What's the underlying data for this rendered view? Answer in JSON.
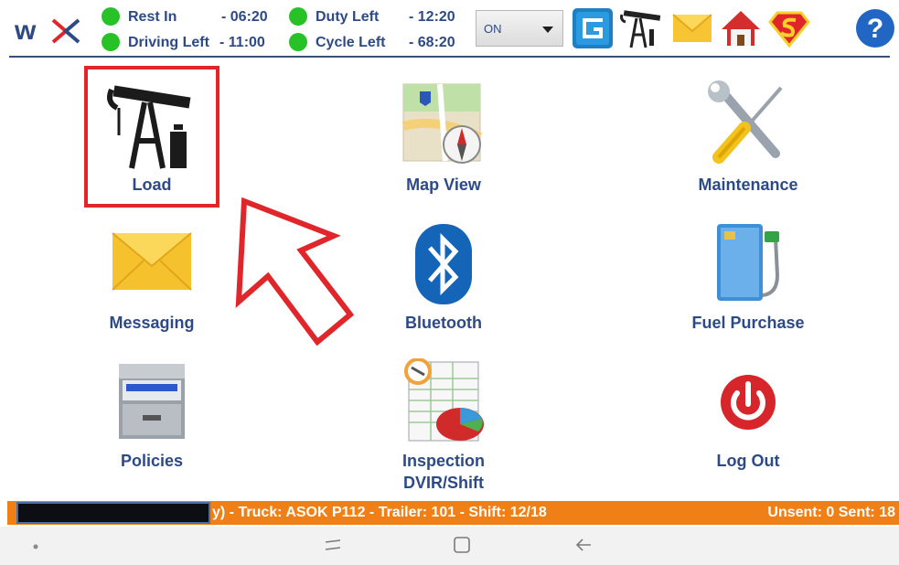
{
  "status": {
    "rest_in_label": "Rest In",
    "rest_in_value": "- 06:20",
    "driving_left_label": "Driving Left",
    "driving_left_value": "- 11:00",
    "duty_left_label": "Duty Left",
    "duty_left_value": "- 12:20",
    "cycle_left_label": "Cycle Left",
    "cycle_left_value": "- 68:20",
    "indicator_color": "#27c227"
  },
  "duty_select": {
    "selected": "ON"
  },
  "header_icons": [
    "g-app-icon",
    "pumpjack-icon",
    "envelope-icon",
    "home-icon",
    "superman-icon",
    "help-icon"
  ],
  "tiles": {
    "load": "Load",
    "map_view": "Map View",
    "maintenance": "Maintenance",
    "messaging": "Messaging",
    "bluetooth": "Bluetooth",
    "fuel_purchase": "Fuel Purchase",
    "policies": "Policies",
    "inspection_line1": "Inspection",
    "inspection_line2": "DVIR/Shift",
    "log_out": "Log Out"
  },
  "footer": {
    "info": "y)  -  Truck: ASOK P112  -  Trailer: 101  -  Shift: 12/18",
    "counts": "Unsent: 0  Sent: 18"
  },
  "colors": {
    "brand_blue": "#2d4a86",
    "footer_orange": "#f07f16",
    "highlight_red": "#e0262b"
  }
}
